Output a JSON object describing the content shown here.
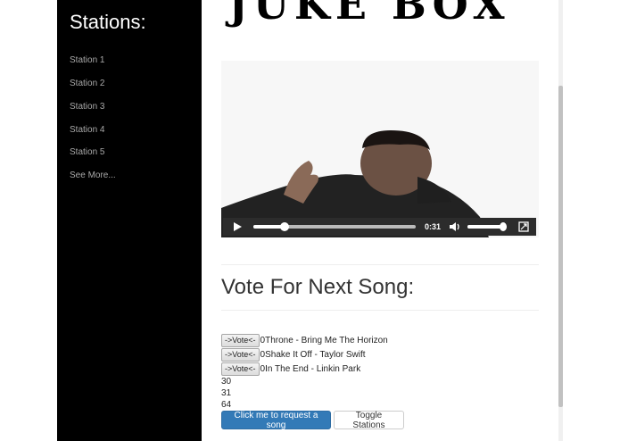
{
  "sidebar": {
    "title": "Stations:",
    "items": [
      {
        "label": "Station 1"
      },
      {
        "label": "Station 2"
      },
      {
        "label": "Station 3"
      },
      {
        "label": "Station 4"
      },
      {
        "label": "Station 5"
      },
      {
        "label": "See More..."
      }
    ]
  },
  "logo": {
    "text": "JUKE BOX"
  },
  "video": {
    "current_time": "0:31",
    "progress_fraction": 0.19,
    "volume_fraction": 0.92,
    "controls": [
      "play-icon",
      "volume-icon",
      "fullscreen-icon"
    ]
  },
  "vote": {
    "heading": "Vote For Next Song:",
    "button_label": "->Vote<-",
    "songs": [
      {
        "votes": "0",
        "title": "Throne - Bring Me The Horizon"
      },
      {
        "votes": "0",
        "title": "Shake It Off - Taylor Swift"
      },
      {
        "votes": "0",
        "title": "In The End - Linkin Park"
      }
    ],
    "numbers": [
      "30",
      "31",
      "64"
    ]
  },
  "actions": {
    "request_label": "Click me to request a song",
    "toggle_label": "Toggle Stations"
  },
  "colors": {
    "sidebar_bg": "#000000",
    "primary_button": "#337ab7",
    "sidebar_text": "#a8a8a8"
  }
}
